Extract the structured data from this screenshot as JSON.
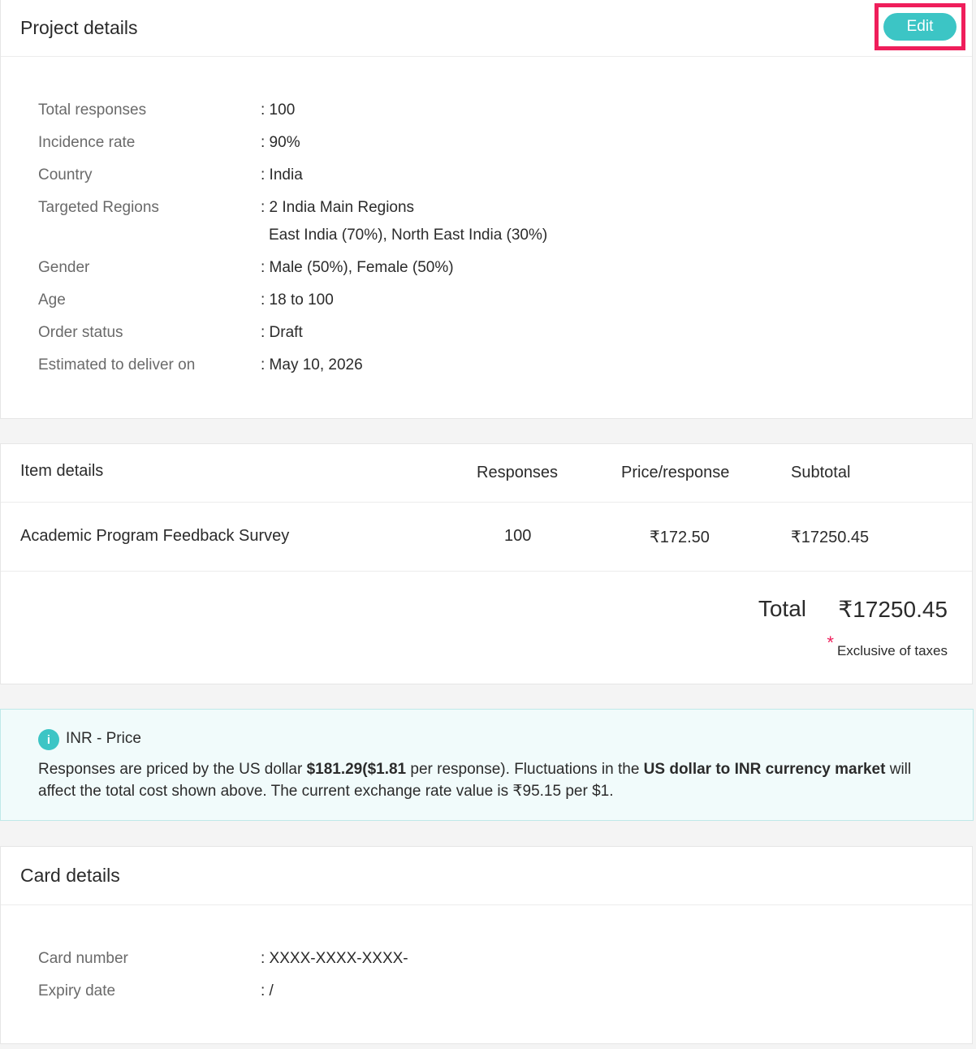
{
  "project": {
    "title": "Project details",
    "edit_label": "Edit",
    "rows": [
      {
        "label": "Total responses",
        "value": ": 100"
      },
      {
        "label": "Incidence rate",
        "value": ": 90%"
      },
      {
        "label": "Country",
        "value": ": India"
      },
      {
        "label": "Targeted Regions",
        "value": ": 2 India Main Regions",
        "sub": "East India (70%),  North East India (30%)"
      },
      {
        "label": "Gender",
        "value": ": Male (50%), Female (50%)"
      },
      {
        "label": "Age",
        "value": ": 18 to 100"
      },
      {
        "label": "Order status",
        "value": ": Draft"
      },
      {
        "label": "Estimated to deliver on",
        "value": ": May 10, 2026"
      }
    ]
  },
  "items": {
    "title": "Item details",
    "headers": {
      "responses": "Responses",
      "price": "Price/response",
      "subtotal": "Subtotal"
    },
    "row": {
      "name": "Academic Program Feedback Survey",
      "responses": "100",
      "price": "₹172.50",
      "subtotal": "₹17250.45"
    },
    "total_label": "Total",
    "total_value": "₹17250.45",
    "star": "*",
    "note": "Exclusive of taxes"
  },
  "info": {
    "icon": "i",
    "title": "INR - Price",
    "t1": "Responses are priced by the US dollar ",
    "b1": "$181.29($1.81",
    "t2": " per response). Fluctuations in the ",
    "b2": "US dollar to INR currency market",
    "t3": " will affect the total cost shown above. The current exchange rate value is ₹95.15 per $1."
  },
  "card": {
    "title": "Card details",
    "rows": [
      {
        "label": "Card number",
        "value": ": XXXX-XXXX-XXXX-"
      },
      {
        "label": "Expiry date",
        "value": ": /"
      }
    ]
  },
  "colors": {
    "accent": "#3cc5c5",
    "highlight": "#ef1e5b"
  }
}
